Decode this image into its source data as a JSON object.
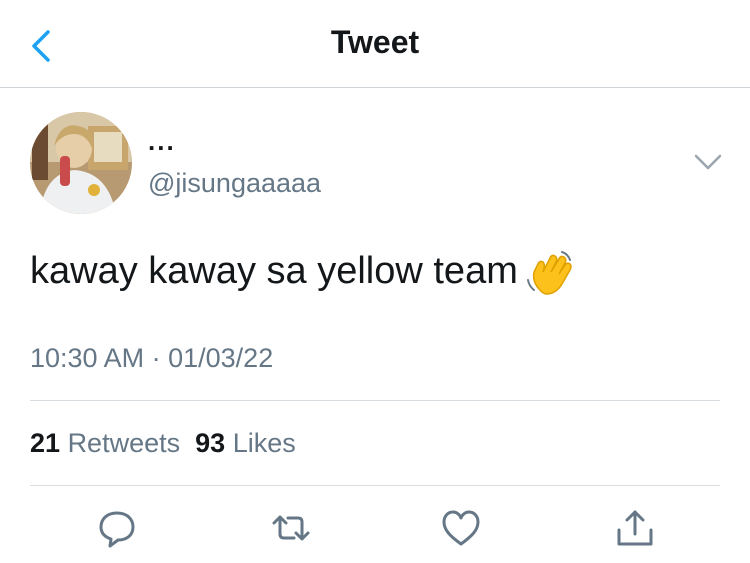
{
  "header": {
    "title": "Tweet"
  },
  "tweet": {
    "display_name": "...",
    "handle": "@jisungaaaaa",
    "text": "kaway kaway sa yellow team",
    "emoji": "waving-hand",
    "time": "10:30 AM",
    "separator": "·",
    "date": "01/03/22",
    "retweets_count": "21",
    "retweets_label": "Retweets",
    "likes_count": "93",
    "likes_label": "Likes"
  },
  "colors": {
    "accent": "#1da1f2",
    "secondary_text": "#657786",
    "primary_text": "#14171a",
    "divider": "#d8dde2"
  }
}
